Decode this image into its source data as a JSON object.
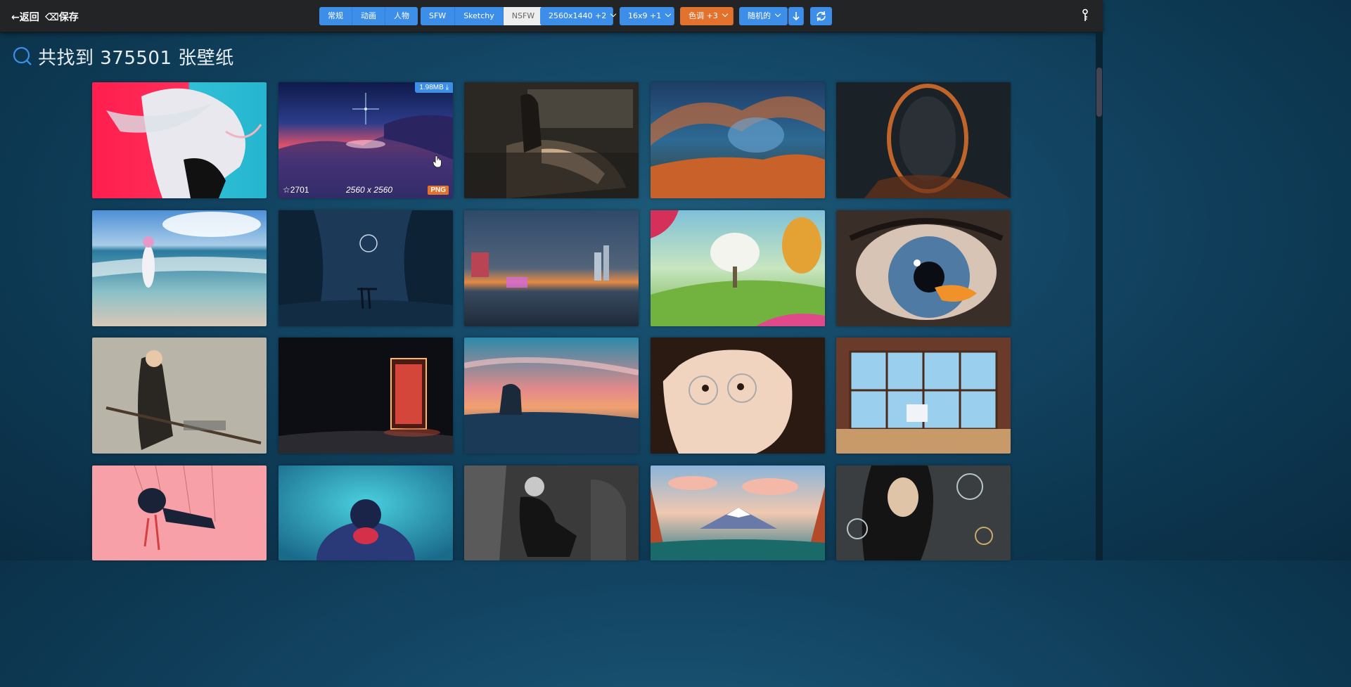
{
  "topbar": {
    "back_label": "←返回",
    "save_label": "⌫保存",
    "categories": [
      "常规",
      "动画",
      "人物"
    ],
    "purity": [
      "SFW",
      "Sketchy",
      "NSFW"
    ],
    "resolution": "2560x1440 +2",
    "ratio": "16x9 +1",
    "color": "色调 +3",
    "sort": "随机的",
    "sort_order_icon": "arrow-down-icon",
    "refresh_icon": "refresh-icon",
    "key_icon": "key-icon"
  },
  "colors": {
    "accent": "#3d8ee8",
    "orange": "#e2722d",
    "topbar": "#232426"
  },
  "result": {
    "text": "共找到 375501 张壁纸"
  },
  "hovered_thumb": {
    "size_label": "1.98MB",
    "favorites": "2701",
    "resolution": "2560 x 2560",
    "format": "PNG"
  }
}
